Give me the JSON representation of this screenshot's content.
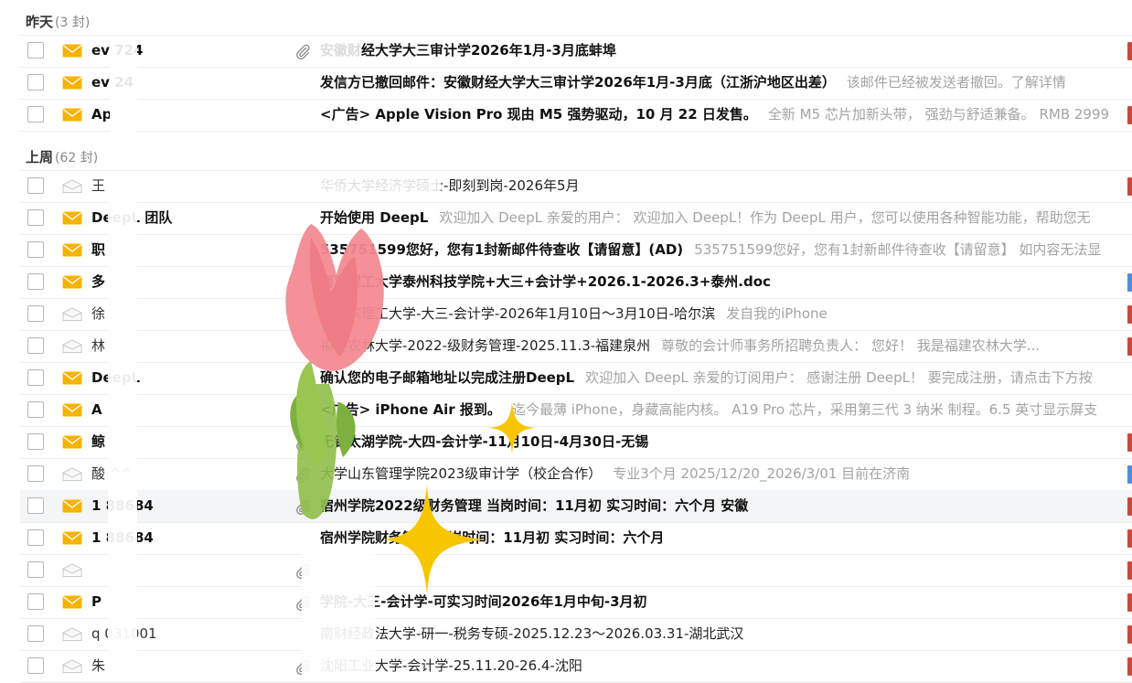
{
  "colors": {
    "unread_envelope": "#f5b400",
    "read_envelope": "#c9c9c9",
    "flag_red": "#c84b3a",
    "flag_blue": "#4a90d9",
    "preview_text": "#a3a3a3",
    "tulip_petal": "#f28a92",
    "tulip_stem": "#8fbf4a",
    "sparkle": "#f7c600"
  },
  "groups": [
    {
      "label": "昨天",
      "count_text": "(3 封)",
      "rows": [
        {
          "sender": "ev   724",
          "subject": "安徽财经大学大三审计学2026年1月-3月底蚌埠",
          "preview": "",
          "unread": true,
          "attachment": true,
          "flag": "red",
          "highlight": false
        },
        {
          "sender": "ev   24",
          "subject": "发信方已撤回邮件：安徽财经大学大三审计学2026年1月-3月底（江浙沪地区出差）",
          "preview": "该邮件已经被发送者撤回。了解详情",
          "unread": true,
          "attachment": false,
          "flag": "none",
          "highlight": false
        },
        {
          "sender": "Ap",
          "subject": "<广告> Apple Vision Pro 现由 M5 强势驱动，10 月 22 日发售。",
          "preview": "全新 M5 芯片加新头带， 强劲与舒适兼备。 RMB 2999",
          "unread": true,
          "attachment": false,
          "flag": "red",
          "highlight": false
        }
      ]
    },
    {
      "label": "上周",
      "count_text": "(62 封)",
      "rows": [
        {
          "sender": "王",
          "subject": "华侨大学经济学硕士-即刻到岗-2026年5月",
          "preview": "",
          "unread": false,
          "attachment": false,
          "flag": "red",
          "highlight": false
        },
        {
          "sender": "DeepL 团队",
          "subject": "开始使用 DeepL",
          "preview": "欢迎加入 DeepL 亲爱的用户： 欢迎加入 DeepL！作为 DeepL 用户，您可以使用各种智能功能，帮助您无",
          "unread": true,
          "attachment": false,
          "flag": "none",
          "highlight": false
        },
        {
          "sender": "职",
          "subject": "535751599您好，您有1封新邮件待查收【请留意】(AD)",
          "preview": "535751599您好，您有1封新邮件待查收【请留意】 如内容无法显",
          "unread": true,
          "attachment": false,
          "flag": "none",
          "highlight": false
        },
        {
          "sender": "多",
          "subject": "南京理工大学泰州科技学院+大三+会计学+2026.1-2026.3+泰州.doc",
          "preview": "",
          "unread": true,
          "attachment": false,
          "flag": "blue",
          "highlight": false
        },
        {
          "sender": "徐",
          "subject": "哈尔滨理工大学-大三-会计学-2026年1月10日～3月10日-哈尔滨",
          "preview": "发自我的iPhone",
          "unread": false,
          "attachment": false,
          "flag": "red",
          "highlight": false
        },
        {
          "sender": "林",
          "subject": "福建农林大学-2022-级财务管理-2025.11.3-福建泉州",
          "preview": "尊敬的会计师事务所招聘负责人： 您好！ 我是福建农林大学...",
          "unread": false,
          "attachment": false,
          "flag": "red",
          "highlight": false
        },
        {
          "sender": "DeepL",
          "subject": "确认您的电子邮箱地址以完成注册DeepL",
          "preview": "欢迎加入 DeepL 亲爱的订阅用户： 感谢注册 DeepL！ 要完成注册，请点击下方按",
          "unread": true,
          "attachment": false,
          "flag": "none",
          "highlight": false
        },
        {
          "sender": "A",
          "subject": "<广告> iPhone Air 报到。",
          "preview": "迄今最薄 iPhone，身藏高能内核。 A19 Pro 芯片，采用第三代 3 纳米 制程。6.5 英寸显示屏支",
          "unread": true,
          "attachment": false,
          "flag": "none",
          "highlight": false
        },
        {
          "sender": "鲸",
          "subject": "无锡太湖学院-大四-会计学-11月10日-4月30日-无锡",
          "preview": "",
          "unread": true,
          "attachment": true,
          "flag": "red",
          "highlight": false
        },
        {
          "sender": "酸 ^^",
          "subject": "大学山东管理学院2023级审计学（校企合作）",
          "preview": "专业3个月 2025/12/20_2026/3/01 目前在济南",
          "unread": false,
          "attachment": true,
          "flag": "blue",
          "highlight": false
        },
        {
          "sender": "1  88684",
          "subject": "宿州学院2022级财务管理 当岗时间：11月初 实习时间：六个月 安徽",
          "preview": "",
          "unread": true,
          "attachment": true,
          "flag": "red",
          "highlight": true
        },
        {
          "sender": "1  88684",
          "subject": "宿州学院财务管理 当岗时间：11月初 实习时间：六个月",
          "preview": "",
          "unread": true,
          "attachment": false,
          "flag": "red",
          "highlight": false
        },
        {
          "sender": "",
          "subject": "",
          "preview": "",
          "unread": false,
          "attachment": true,
          "flag": "red",
          "highlight": false
        },
        {
          "sender": "P",
          "subject": "学院-大三-会计学-可实习时间2026年1月中旬-3月初",
          "preview": "",
          "unread": true,
          "attachment": true,
          "flag": "red",
          "highlight": false
        },
        {
          "sender": "q  031001",
          "subject": "南财经政法大学-研一-税务专硕-2025.12.23～2026.03.31-湖北武汉",
          "preview": "",
          "unread": false,
          "attachment": false,
          "flag": "red",
          "highlight": false
        },
        {
          "sender": "朱",
          "subject": "沈阳工业大学-会计学-25.11.20-26.4-沈阳",
          "preview": "",
          "unread": false,
          "attachment": true,
          "flag": "red",
          "highlight": false
        }
      ]
    }
  ]
}
